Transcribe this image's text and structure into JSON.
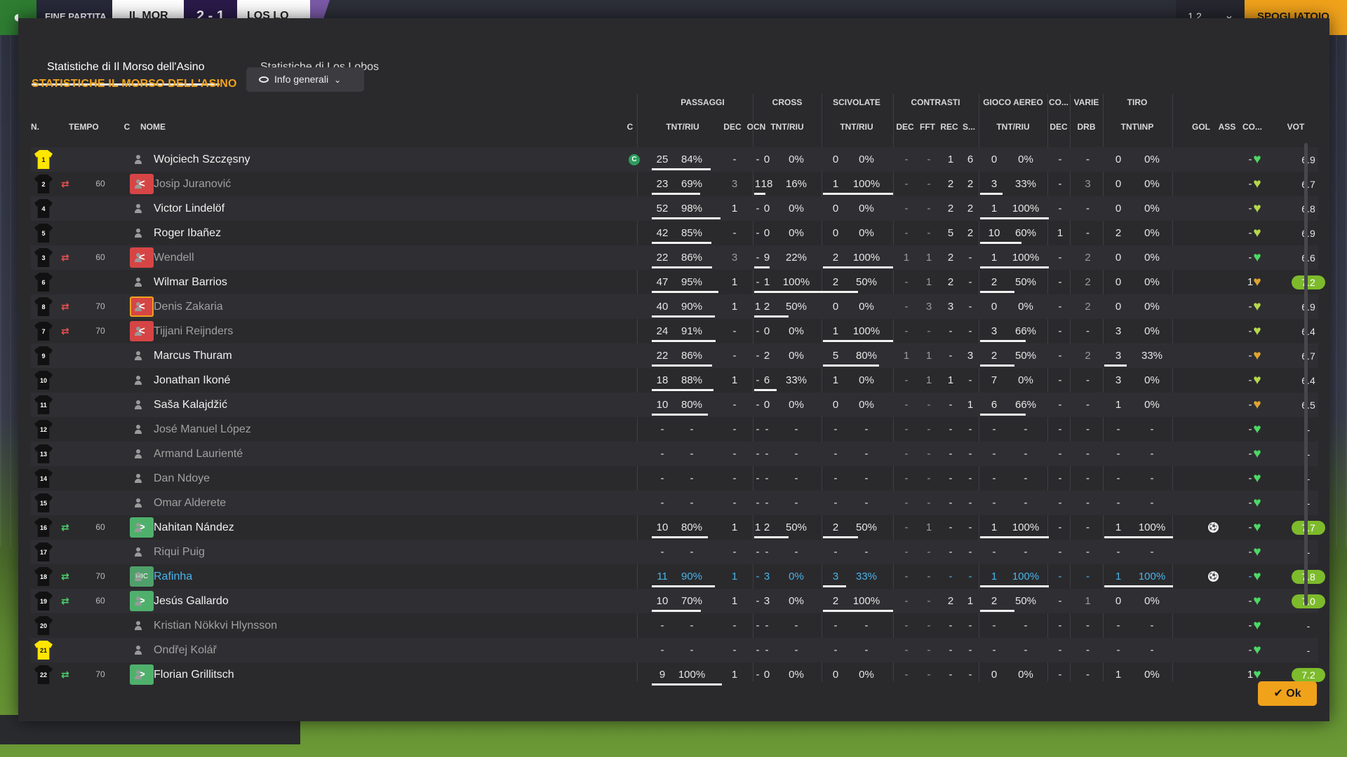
{
  "topbar": {
    "status": "FINE PARTITA",
    "home_team": "IL MOR",
    "score": "2 - 1",
    "away_team": "LOS LO",
    "menu": "1 2",
    "continue_label": "SPOGLIATOIO"
  },
  "tabs": [
    {
      "label": "Statistiche di Il Morso dell'Asino",
      "active": true
    },
    {
      "label": "Statistiche di Los Lobos",
      "active": false
    }
  ],
  "panel_title": "STATISTICHE IL MORSO DELL'ASINO",
  "view_dropdown": "Info generali",
  "group_headers": [
    "PASSAGGI",
    "CROSS",
    "SCIVOLATE",
    "CONTRASTI",
    "GIOCO AEREO",
    "CO...",
    "VARIE",
    "TIRO"
  ],
  "column_headers": {
    "num": "N.",
    "tempo": "TEMPO",
    "c": "C",
    "nome": "NOME",
    "cap": "C",
    "pass_tnt": "TNT/RIU",
    "pass_dec": "DEC",
    "pass_ocn": "OCN",
    "cross_tnt": "TNT/RIU",
    "sciv_tnt": "TNT/RIU",
    "con_dec": "DEC",
    "con_fft": "FFT",
    "con_rec": "REC",
    "con_s": "S...",
    "aereo_tnt": "TNT/RIU",
    "co_dec": "DEC",
    "varie_drb": "DRB",
    "tiro_tnt": "TNT\\INP",
    "gol": "GOL",
    "ass": "ASS",
    "co": "CO...",
    "vot": "VOT"
  },
  "players": [
    {
      "num": "1",
      "gk": true,
      "sub": "",
      "min": "",
      "c": "",
      "name": "Wojciech Szczęsny",
      "dim": false,
      "blue": false,
      "captain": "C",
      "pt": "25",
      "pp": "84%",
      "pbar": 0.84,
      "pd": "-",
      "po": "-",
      "ct": "0",
      "cp": "0%",
      "cbar": 0,
      "st": "0",
      "sp": "0%",
      "sbar": 0,
      "c1": "-",
      "c2": "-",
      "c3": "1",
      "c4": "6",
      "at": "0",
      "ap": "0%",
      "abar": 0,
      "cd": "-",
      "dr": "-",
      "tt": "0",
      "tp": "0%",
      "tbar": 0,
      "gol": "",
      "ass": "-",
      "morale": "great",
      "vot": "6.9",
      "vhi": false
    },
    {
      "num": "2",
      "gk": false,
      "sub": "out",
      "min": "60",
      "c": "red",
      "name": "Josip Juranović",
      "dim": true,
      "blue": false,
      "captain": "",
      "pt": "23",
      "pp": "69%",
      "pbar": 0.69,
      "pd": "3",
      "po": "1",
      "ct": "18",
      "cp": "16%",
      "cbar": 0.16,
      "st": "1",
      "sp": "100%",
      "sbar": 1,
      "c1": "-",
      "c2": "-",
      "c3": "2",
      "c4": "2",
      "at": "3",
      "ap": "33%",
      "abar": 0.33,
      "cd": "-",
      "dr": "3",
      "tt": "0",
      "tp": "0%",
      "tbar": 0,
      "gol": "",
      "ass": "-",
      "morale": "good",
      "vot": "6.7",
      "vhi": false
    },
    {
      "num": "4",
      "gk": false,
      "sub": "",
      "min": "",
      "c": "",
      "name": "Victor Lindelöf",
      "dim": false,
      "blue": false,
      "captain": "",
      "pt": "52",
      "pp": "98%",
      "pbar": 0.98,
      "pd": "1",
      "po": "-",
      "ct": "0",
      "cp": "0%",
      "cbar": 0,
      "st": "0",
      "sp": "0%",
      "sbar": 0,
      "c1": "-",
      "c2": "-",
      "c3": "2",
      "c4": "2",
      "at": "1",
      "ap": "100%",
      "abar": 1,
      "cd": "-",
      "dr": "-",
      "tt": "0",
      "tp": "0%",
      "tbar": 0,
      "gol": "",
      "ass": "-",
      "morale": "good",
      "vot": "6.8",
      "vhi": false
    },
    {
      "num": "5",
      "gk": false,
      "sub": "",
      "min": "",
      "c": "",
      "name": "Roger Ibañez",
      "dim": false,
      "blue": false,
      "captain": "",
      "pt": "42",
      "pp": "85%",
      "pbar": 0.85,
      "pd": "-",
      "po": "-",
      "ct": "0",
      "cp": "0%",
      "cbar": 0,
      "st": "0",
      "sp": "0%",
      "sbar": 0,
      "c1": "-",
      "c2": "-",
      "c3": "5",
      "c4": "2",
      "at": "10",
      "ap": "60%",
      "abar": 0.6,
      "cd": "1",
      "dr": "-",
      "tt": "2",
      "tp": "0%",
      "tbar": 0,
      "gol": "",
      "ass": "-",
      "morale": "good",
      "vot": "6.9",
      "vhi": false
    },
    {
      "num": "3",
      "gk": false,
      "sub": "out",
      "min": "60",
      "c": "red",
      "name": "Wendell",
      "dim": true,
      "blue": false,
      "captain": "",
      "pt": "22",
      "pp": "86%",
      "pbar": 0.86,
      "pd": "3",
      "po": "-",
      "ct": "9",
      "cp": "22%",
      "cbar": 0.22,
      "st": "2",
      "sp": "100%",
      "sbar": 1,
      "c1": "1",
      "c2": "1",
      "c3": "2",
      "c4": "-",
      "at": "1",
      "ap": "100%",
      "abar": 1,
      "cd": "-",
      "dr": "2",
      "tt": "0",
      "tp": "0%",
      "tbar": 0,
      "gol": "",
      "ass": "-",
      "morale": "great",
      "vot": "6.6",
      "vhi": false
    },
    {
      "num": "6",
      "gk": false,
      "sub": "",
      "min": "",
      "c": "",
      "name": "Wilmar Barrios",
      "dim": false,
      "blue": false,
      "captain": "",
      "pt": "47",
      "pp": "95%",
      "pbar": 0.95,
      "pd": "1",
      "po": "-",
      "ct": "1",
      "cp": "100%",
      "cbar": 1,
      "st": "2",
      "sp": "50%",
      "sbar": 0.5,
      "c1": "-",
      "c2": "1",
      "c3": "2",
      "c4": "-",
      "at": "2",
      "ap": "50%",
      "abar": 0.5,
      "cd": "-",
      "dr": "2",
      "tt": "0",
      "tp": "0%",
      "tbar": 0,
      "gol": "",
      "ass": "1",
      "morale": "ok",
      "vot": "7.2",
      "vhi": true
    },
    {
      "num": "8",
      "gk": false,
      "sub": "out",
      "min": "70",
      "c": "red",
      "cy": true,
      "name": "Denis Zakaria",
      "dim": true,
      "blue": false,
      "captain": "",
      "pt": "40",
      "pp": "90%",
      "pbar": 0.9,
      "pd": "1",
      "po": "1",
      "ct": "2",
      "cp": "50%",
      "cbar": 0.5,
      "st": "0",
      "sp": "0%",
      "sbar": 0,
      "c1": "-",
      "c2": "3",
      "c3": "3",
      "c4": "-",
      "at": "0",
      "ap": "0%",
      "abar": 0,
      "cd": "-",
      "dr": "2",
      "tt": "0",
      "tp": "0%",
      "tbar": 0,
      "gol": "",
      "ass": "-",
      "morale": "good",
      "vot": "6.9",
      "vhi": false
    },
    {
      "num": "7",
      "gk": false,
      "sub": "out",
      "min": "70",
      "c": "red",
      "name": "Tijjani Reijnders",
      "dim": true,
      "blue": false,
      "captain": "",
      "pt": "24",
      "pp": "91%",
      "pbar": 0.91,
      "pd": "-",
      "po": "-",
      "ct": "0",
      "cp": "0%",
      "cbar": 0,
      "st": "1",
      "sp": "100%",
      "sbar": 1,
      "c1": "-",
      "c2": "-",
      "c3": "-",
      "c4": "-",
      "at": "3",
      "ap": "66%",
      "abar": 0.66,
      "cd": "-",
      "dr": "-",
      "tt": "3",
      "tp": "0%",
      "tbar": 0,
      "gol": "",
      "ass": "-",
      "morale": "good",
      "vot": "6.4",
      "vhi": false
    },
    {
      "num": "9",
      "gk": false,
      "sub": "",
      "min": "",
      "c": "",
      "name": "Marcus Thuram",
      "dim": false,
      "blue": false,
      "captain": "",
      "pt": "22",
      "pp": "86%",
      "pbar": 0.86,
      "pd": "-",
      "po": "-",
      "ct": "2",
      "cp": "0%",
      "cbar": 0,
      "st": "5",
      "sp": "80%",
      "sbar": 0.8,
      "c1": "1",
      "c2": "1",
      "c3": "-",
      "c4": "3",
      "at": "2",
      "ap": "50%",
      "abar": 0.5,
      "cd": "-",
      "dr": "2",
      "tt": "3",
      "tp": "33%",
      "tbar": 0.33,
      "gol": "",
      "ass": "-",
      "morale": "ok",
      "vot": "6.7",
      "vhi": false
    },
    {
      "num": "10",
      "gk": false,
      "sub": "",
      "min": "",
      "c": "",
      "name": "Jonathan Ikoné",
      "dim": false,
      "blue": false,
      "captain": "",
      "pt": "18",
      "pp": "88%",
      "pbar": 0.88,
      "pd": "1",
      "po": "-",
      "ct": "6",
      "cp": "33%",
      "cbar": 0.33,
      "st": "1",
      "sp": "0%",
      "sbar": 0,
      "c1": "-",
      "c2": "1",
      "c3": "1",
      "c4": "-",
      "at": "7",
      "ap": "0%",
      "abar": 0,
      "cd": "-",
      "dr": "-",
      "tt": "3",
      "tp": "0%",
      "tbar": 0,
      "gol": "",
      "ass": "-",
      "morale": "good",
      "vot": "6.4",
      "vhi": false
    },
    {
      "num": "11",
      "gk": false,
      "sub": "",
      "min": "",
      "c": "",
      "name": "Saša Kalajdžić",
      "dim": false,
      "blue": false,
      "captain": "",
      "pt": "10",
      "pp": "80%",
      "pbar": 0.8,
      "pd": "-",
      "po": "-",
      "ct": "0",
      "cp": "0%",
      "cbar": 0,
      "st": "0",
      "sp": "0%",
      "sbar": 0,
      "c1": "-",
      "c2": "-",
      "c3": "-",
      "c4": "1",
      "at": "6",
      "ap": "66%",
      "abar": 0.66,
      "cd": "-",
      "dr": "-",
      "tt": "1",
      "tp": "0%",
      "tbar": 0,
      "gol": "",
      "ass": "-",
      "morale": "ok",
      "vot": "6.5",
      "vhi": false
    },
    {
      "num": "12",
      "gk": false,
      "sub": "",
      "min": "",
      "c": "",
      "name": "José Manuel López",
      "dim": true,
      "blue": false,
      "captain": "",
      "pt": "-",
      "pp": "-",
      "pbar": 0,
      "pd": "-",
      "po": "-",
      "ct": "-",
      "cp": "-",
      "cbar": 0,
      "st": "-",
      "sp": "-",
      "sbar": 0,
      "c1": "-",
      "c2": "-",
      "c3": "-",
      "c4": "-",
      "at": "-",
      "ap": "-",
      "abar": 0,
      "cd": "-",
      "dr": "-",
      "tt": "-",
      "tp": "-",
      "tbar": 0,
      "gol": "",
      "ass": "-",
      "morale": "great",
      "vot": "-",
      "vhi": false
    },
    {
      "num": "13",
      "gk": false,
      "sub": "",
      "min": "",
      "c": "",
      "name": "Armand Laurienté",
      "dim": true,
      "blue": false,
      "captain": "",
      "pt": "-",
      "pp": "-",
      "pbar": 0,
      "pd": "-",
      "po": "-",
      "ct": "-",
      "cp": "-",
      "cbar": 0,
      "st": "-",
      "sp": "-",
      "sbar": 0,
      "c1": "-",
      "c2": "-",
      "c3": "-",
      "c4": "-",
      "at": "-",
      "ap": "-",
      "abar": 0,
      "cd": "-",
      "dr": "-",
      "tt": "-",
      "tp": "-",
      "tbar": 0,
      "gol": "",
      "ass": "-",
      "morale": "great",
      "vot": "-",
      "vhi": false
    },
    {
      "num": "14",
      "gk": false,
      "sub": "",
      "min": "",
      "c": "",
      "name": "Dan Ndoye",
      "dim": true,
      "blue": false,
      "captain": "",
      "pt": "-",
      "pp": "-",
      "pbar": 0,
      "pd": "-",
      "po": "-",
      "ct": "-",
      "cp": "-",
      "cbar": 0,
      "st": "-",
      "sp": "-",
      "sbar": 0,
      "c1": "-",
      "c2": "-",
      "c3": "-",
      "c4": "-",
      "at": "-",
      "ap": "-",
      "abar": 0,
      "cd": "-",
      "dr": "-",
      "tt": "-",
      "tp": "-",
      "tbar": 0,
      "gol": "",
      "ass": "-",
      "morale": "great",
      "vot": "-",
      "vhi": false
    },
    {
      "num": "15",
      "gk": false,
      "sub": "",
      "min": "",
      "c": "",
      "name": "Omar Alderete",
      "dim": true,
      "blue": false,
      "captain": "",
      "pt": "-",
      "pp": "-",
      "pbar": 0,
      "pd": "-",
      "po": "-",
      "ct": "-",
      "cp": "-",
      "cbar": 0,
      "st": "-",
      "sp": "-",
      "sbar": 0,
      "c1": "-",
      "c2": "-",
      "c3": "-",
      "c4": "-",
      "at": "-",
      "ap": "-",
      "abar": 0,
      "cd": "-",
      "dr": "-",
      "tt": "-",
      "tp": "-",
      "tbar": 0,
      "gol": "",
      "ass": "-",
      "morale": "great",
      "vot": "-",
      "vhi": false
    },
    {
      "num": "16",
      "gk": false,
      "sub": "in",
      "min": "60",
      "c": "green",
      "name": "Nahitan Nández",
      "dim": false,
      "blue": false,
      "captain": "",
      "pt": "10",
      "pp": "80%",
      "pbar": 0.8,
      "pd": "1",
      "po": "1",
      "ct": "2",
      "cp": "50%",
      "cbar": 0.5,
      "st": "2",
      "sp": "50%",
      "sbar": 0.5,
      "c1": "-",
      "c2": "1",
      "c3": "-",
      "c4": "-",
      "at": "1",
      "ap": "100%",
      "abar": 1,
      "cd": "-",
      "dr": "-",
      "tt": "1",
      "tp": "100%",
      "tbar": 1,
      "gol": "ball",
      "ass": "-",
      "morale": "great",
      "vot": "7.7",
      "vhi": true
    },
    {
      "num": "17",
      "gk": false,
      "sub": "",
      "min": "",
      "c": "",
      "name": "Riqui Puig",
      "dim": true,
      "blue": false,
      "captain": "",
      "pt": "-",
      "pp": "-",
      "pbar": 0,
      "pd": "-",
      "po": "-",
      "ct": "-",
      "cp": "-",
      "cbar": 0,
      "st": "-",
      "sp": "-",
      "sbar": 0,
      "c1": "-",
      "c2": "-",
      "c3": "-",
      "c4": "-",
      "at": "-",
      "ap": "-",
      "abar": 0,
      "cd": "-",
      "dr": "-",
      "tt": "-",
      "tp": "-",
      "tbar": 0,
      "gol": "",
      "ass": "-",
      "morale": "great",
      "vot": "-",
      "vhi": false
    },
    {
      "num": "18",
      "gk": false,
      "sub": "in",
      "min": "70",
      "c": "mic",
      "name": "Rafinha",
      "dim": false,
      "blue": true,
      "captain": "",
      "pt": "11",
      "pp": "90%",
      "pbar": 0.9,
      "pd": "1",
      "po": "-",
      "ct": "3",
      "cp": "0%",
      "cbar": 0,
      "st": "3",
      "sp": "33%",
      "sbar": 0.33,
      "c1": "-",
      "c2": "-",
      "c3": "-",
      "c4": "-",
      "at": "1",
      "ap": "100%",
      "abar": 1,
      "cd": "-",
      "dr": "-",
      "tt": "1",
      "tp": "100%",
      "tbar": 1,
      "gol": "ball",
      "ass": "-",
      "morale": "great",
      "vot": "7.8",
      "vhi": true
    },
    {
      "num": "19",
      "gk": false,
      "sub": "in",
      "min": "60",
      "c": "green",
      "name": "Jesús Gallardo",
      "dim": false,
      "blue": false,
      "captain": "",
      "pt": "10",
      "pp": "70%",
      "pbar": 0.7,
      "pd": "1",
      "po": "-",
      "ct": "3",
      "cp": "0%",
      "cbar": 0,
      "st": "2",
      "sp": "100%",
      "sbar": 1,
      "c1": "-",
      "c2": "-",
      "c3": "2",
      "c4": "1",
      "at": "2",
      "ap": "50%",
      "abar": 0.5,
      "cd": "-",
      "dr": "1",
      "tt": "0",
      "tp": "0%",
      "tbar": 0,
      "gol": "",
      "ass": "-",
      "morale": "great",
      "vot": "7.0",
      "vhi": true
    },
    {
      "num": "20",
      "gk": false,
      "sub": "",
      "min": "",
      "c": "",
      "name": "Kristian Nökkvi Hlynsson",
      "dim": true,
      "blue": false,
      "captain": "",
      "pt": "-",
      "pp": "-",
      "pbar": 0,
      "pd": "-",
      "po": "-",
      "ct": "-",
      "cp": "-",
      "cbar": 0,
      "st": "-",
      "sp": "-",
      "sbar": 0,
      "c1": "-",
      "c2": "-",
      "c3": "-",
      "c4": "-",
      "at": "-",
      "ap": "-",
      "abar": 0,
      "cd": "-",
      "dr": "-",
      "tt": "-",
      "tp": "-",
      "tbar": 0,
      "gol": "",
      "ass": "-",
      "morale": "great",
      "vot": "-",
      "vhi": false
    },
    {
      "num": "21",
      "gk": true,
      "sub": "",
      "min": "",
      "c": "",
      "name": "Ondřej Kolář",
      "dim": true,
      "blue": false,
      "captain": "",
      "pt": "-",
      "pp": "-",
      "pbar": 0,
      "pd": "-",
      "po": "-",
      "ct": "-",
      "cp": "-",
      "cbar": 0,
      "st": "-",
      "sp": "-",
      "sbar": 0,
      "c1": "-",
      "c2": "-",
      "c3": "-",
      "c4": "-",
      "at": "-",
      "ap": "-",
      "abar": 0,
      "cd": "-",
      "dr": "-",
      "tt": "-",
      "tp": "-",
      "tbar": 0,
      "gol": "",
      "ass": "-",
      "morale": "great",
      "vot": "-",
      "vhi": false
    },
    {
      "num": "22",
      "gk": false,
      "sub": "in",
      "min": "70",
      "c": "green",
      "name": "Florian Grillitsch",
      "dim": false,
      "blue": false,
      "captain": "",
      "pt": "9",
      "pp": "100%",
      "pbar": 1,
      "pd": "1",
      "po": "-",
      "ct": "0",
      "cp": "0%",
      "cbar": 0,
      "st": "0",
      "sp": "0%",
      "sbar": 0,
      "c1": "-",
      "c2": "-",
      "c3": "-",
      "c4": "-",
      "at": "0",
      "ap": "0%",
      "abar": 0,
      "cd": "-",
      "dr": "-",
      "tt": "1",
      "tp": "0%",
      "tbar": 0,
      "gol": "",
      "ass": "1",
      "morale": "great",
      "vot": "7.2",
      "vhi": true
    }
  ],
  "ok_label": "Ok",
  "colors": {
    "accent": "#f0a21b",
    "rating_high": "#7dbb2c",
    "morale_great": "#4cd964",
    "morale_good": "#b5d94a",
    "morale_ok": "#e0a530"
  }
}
